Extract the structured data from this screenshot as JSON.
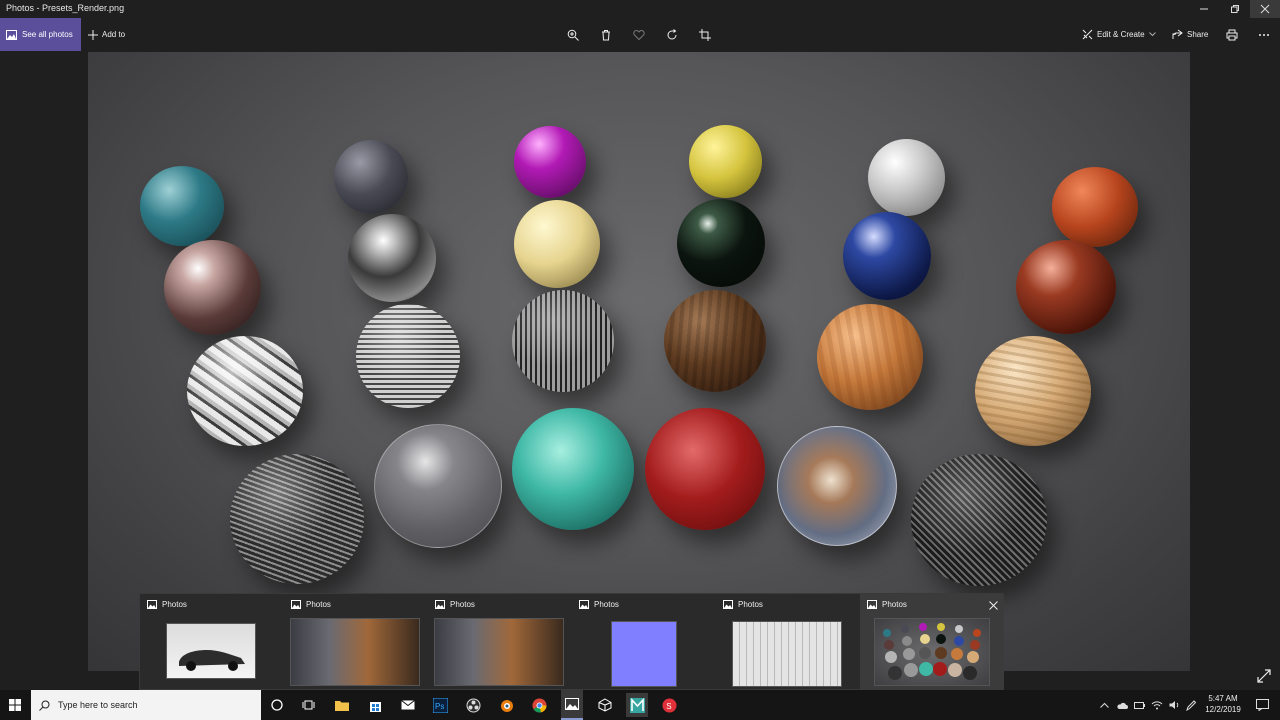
{
  "window": {
    "title": "Photos - Presets_Render.png",
    "controls": [
      "minimize",
      "restore",
      "close"
    ]
  },
  "toolbar": {
    "see_all_label": "See all photos",
    "add_to_label": "Add to",
    "edit_create_label": "Edit & Create",
    "share_label": "Share",
    "icons": [
      "zoom-icon",
      "delete-icon",
      "favorite-icon",
      "rotate-icon",
      "crop-icon"
    ]
  },
  "colors": {
    "accent": "#5b4f9c",
    "background": "#1f1f1f",
    "taskbar": "#151515"
  },
  "thumbnails": [
    {
      "app": "Photos",
      "content": "car"
    },
    {
      "app": "Photos",
      "content": "interior-1"
    },
    {
      "app": "Photos",
      "content": "interior-2"
    },
    {
      "app": "Photos",
      "content": "normal-map"
    },
    {
      "app": "Photos",
      "content": "sketch"
    },
    {
      "app": "Photos",
      "content": "spheres",
      "active": true
    }
  ],
  "taskbar": {
    "search_placeholder": "Type here to search",
    "apps": [
      "cortana",
      "task-view",
      "file-explorer",
      "store",
      "mail",
      "photoshop",
      "obs",
      "blender",
      "chrome",
      "photos",
      "unity",
      "maya",
      "substance"
    ],
    "time": "5:47 AM",
    "date": "12/2/2019"
  }
}
